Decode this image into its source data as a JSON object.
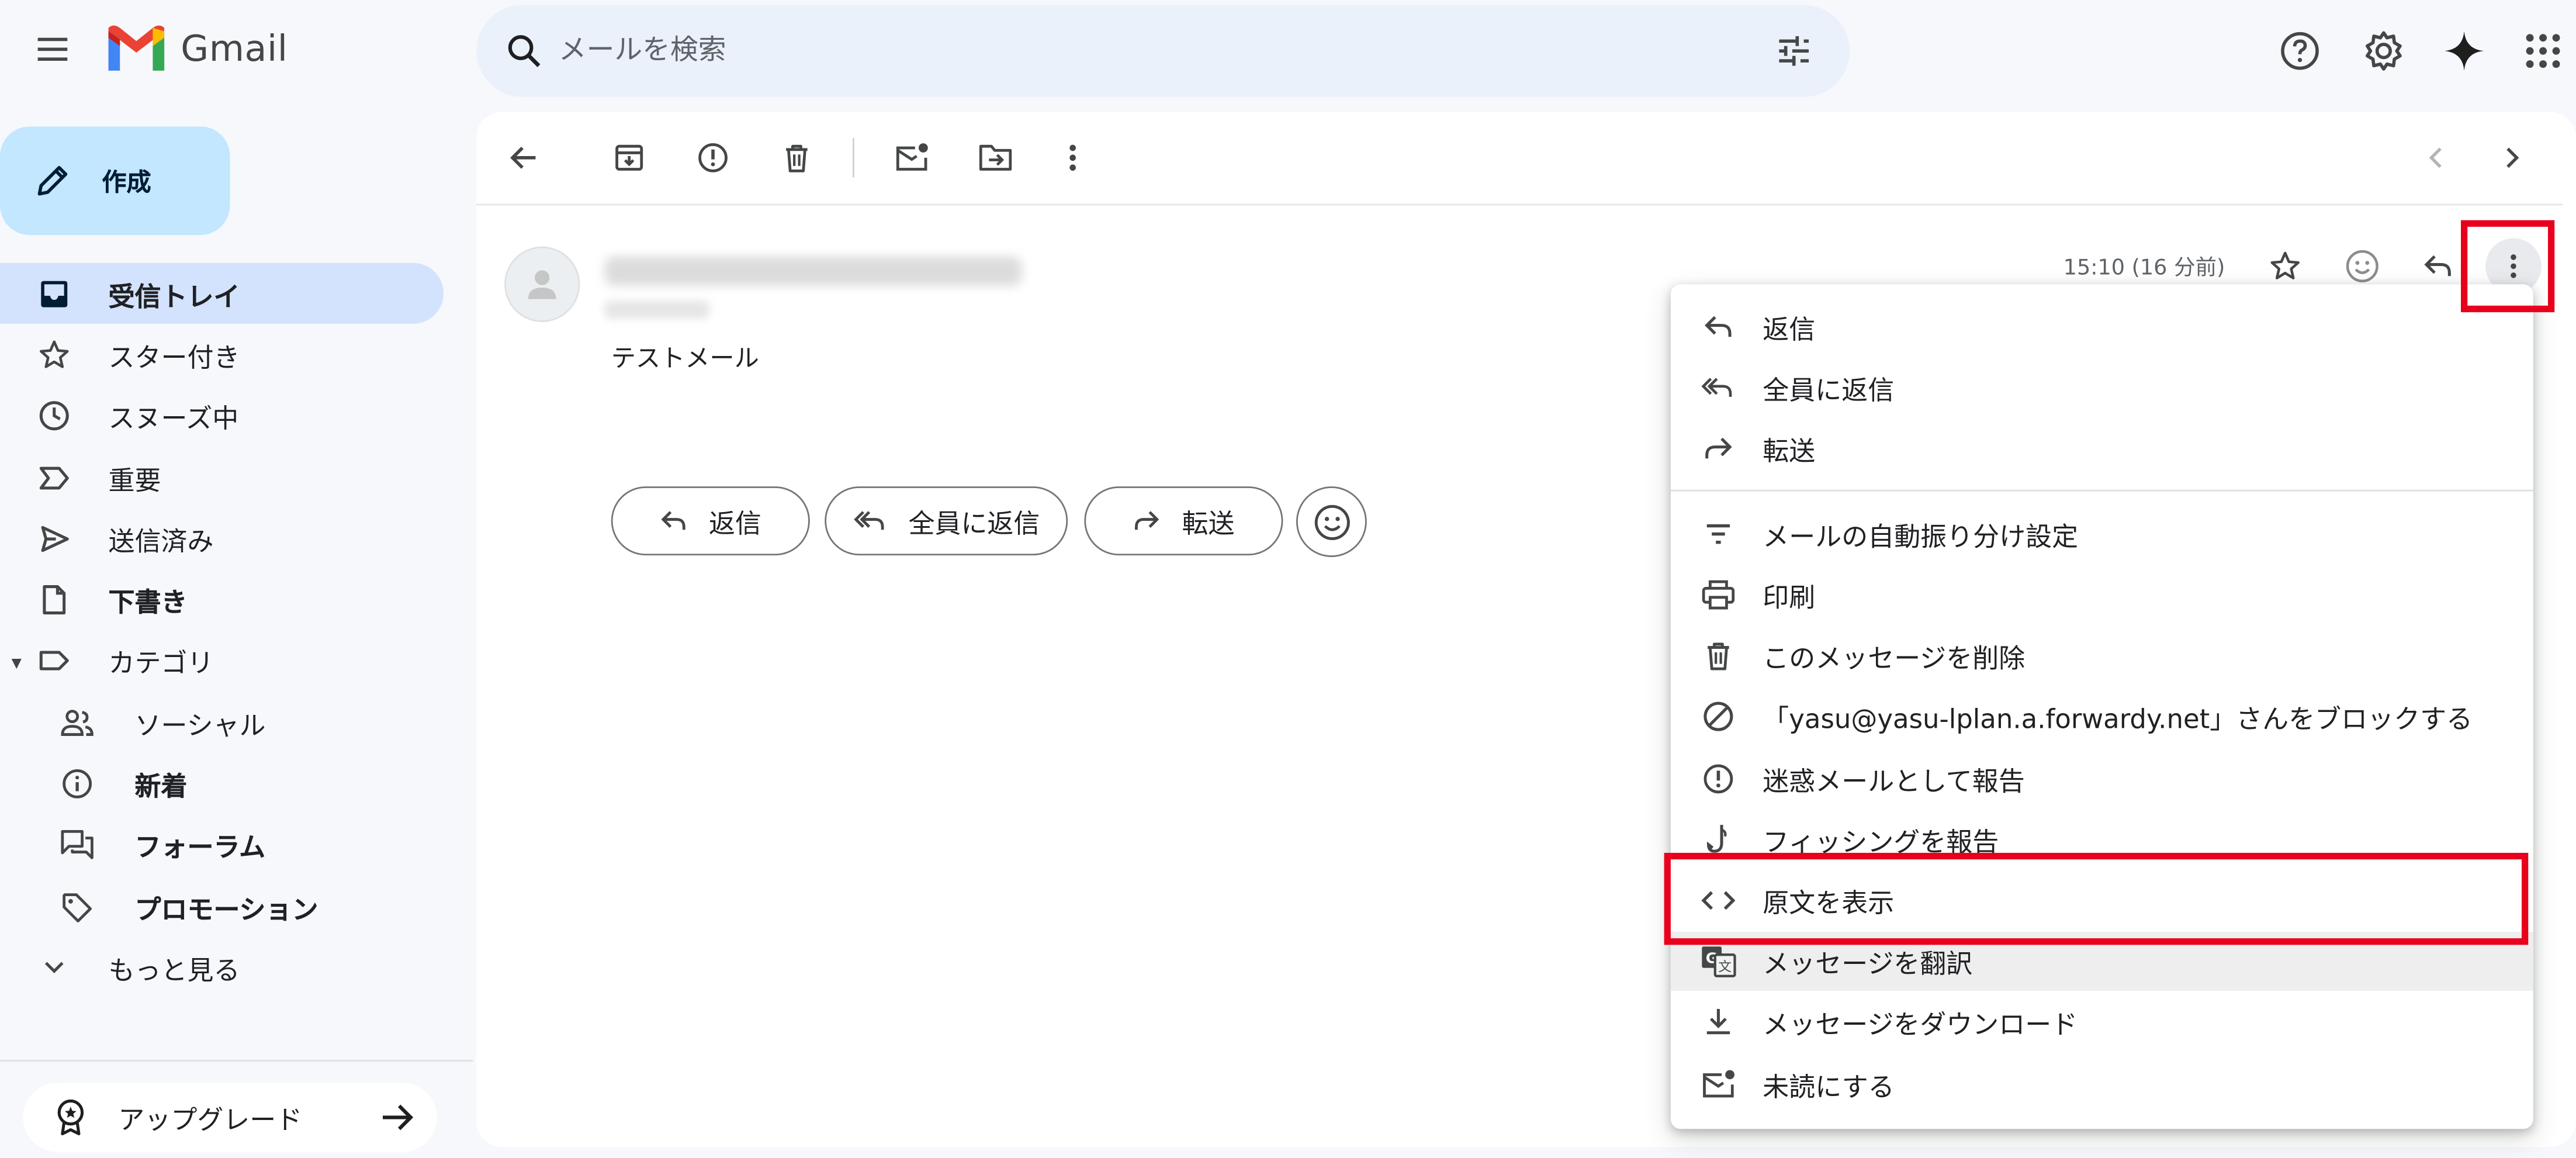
{
  "app": {
    "name": "Gmail"
  },
  "header": {
    "menu_icon": "hamburger-icon",
    "search_placeholder": "メールを検索",
    "search_icon": "search-icon",
    "filter_icon": "tune-icon",
    "right_icons": [
      "help-icon",
      "settings-icon",
      "gemini-sparkle-icon",
      "apps-grid-icon"
    ]
  },
  "sidebar": {
    "compose_label": "作成",
    "items": [
      {
        "label": "受信トレイ",
        "icon": "inbox-icon",
        "active": true
      },
      {
        "label": "スター付き",
        "icon": "star-icon"
      },
      {
        "label": "スヌーズ中",
        "icon": "clock-icon"
      },
      {
        "label": "重要",
        "icon": "important-icon"
      },
      {
        "label": "送信済み",
        "icon": "send-icon"
      },
      {
        "label": "下書き",
        "icon": "draft-icon",
        "bold": true
      },
      {
        "label": "カテゴリ",
        "icon": "label-icon",
        "expandable": true
      },
      {
        "label": "ソーシャル",
        "icon": "people-icon",
        "sub": true
      },
      {
        "label": "新着",
        "icon": "info-icon",
        "sub": true,
        "bold": true
      },
      {
        "label": "フォーラム",
        "icon": "forum-icon",
        "sub": true,
        "bold": true
      },
      {
        "label": "プロモーション",
        "icon": "tag-icon",
        "sub": true,
        "bold": true
      },
      {
        "label": "もっと見る",
        "icon": "chevron-down-icon"
      }
    ],
    "upgrade_label": "アップグレード"
  },
  "toolbar": {
    "icons": [
      "back-icon",
      "archive-icon",
      "report-spam-icon",
      "delete-icon",
      "mark-unread-icon",
      "move-to-icon",
      "more-vert-icon"
    ],
    "nav_icons": [
      "prev-icon",
      "next-icon"
    ]
  },
  "message": {
    "sender_redacted": true,
    "subject": "テストメール",
    "time": "15:10 (16 分前)",
    "action_icons": [
      "star-icon",
      "emoji-icon",
      "reply-icon",
      "more-vert-icon"
    ]
  },
  "reply_buttons": [
    {
      "label": "返信",
      "icon": "reply-icon"
    },
    {
      "label": "全員に返信",
      "icon": "reply-all-icon"
    },
    {
      "label": "転送",
      "icon": "forward-icon"
    }
  ],
  "menu": {
    "items": [
      {
        "label": "返信",
        "icon": "reply-icon"
      },
      {
        "label": "全員に返信",
        "icon": "reply-all-icon"
      },
      {
        "label": "転送",
        "icon": "forward-icon"
      },
      {
        "label": "メールの自動振り分け設定",
        "icon": "filter-icon"
      },
      {
        "label": "印刷",
        "icon": "print-icon"
      },
      {
        "label": "このメッセージを削除",
        "icon": "delete-icon"
      },
      {
        "label": "「yasu@yasu-lplan.a.forwardy.net」さんをブロックする",
        "icon": "block-icon"
      },
      {
        "label": "迷惑メールとして報告",
        "icon": "report-spam-icon"
      },
      {
        "label": "フィッシングを報告",
        "icon": "phishing-icon"
      },
      {
        "label": "原文を表示",
        "icon": "code-icon",
        "highlighted": true
      },
      {
        "label": "メッセージを翻訳",
        "icon": "translate-icon",
        "hovered": true
      },
      {
        "label": "メッセージをダウンロード",
        "icon": "download-icon"
      },
      {
        "label": "未読にする",
        "icon": "mark-unread-icon"
      }
    ]
  },
  "colors": {
    "highlight_box": "#e8001c",
    "compose_bg": "#c2e7ff",
    "active_nav_bg": "#d3e3fd",
    "search_bg": "#eaf1fb",
    "page_bg": "#f6f8fc"
  }
}
